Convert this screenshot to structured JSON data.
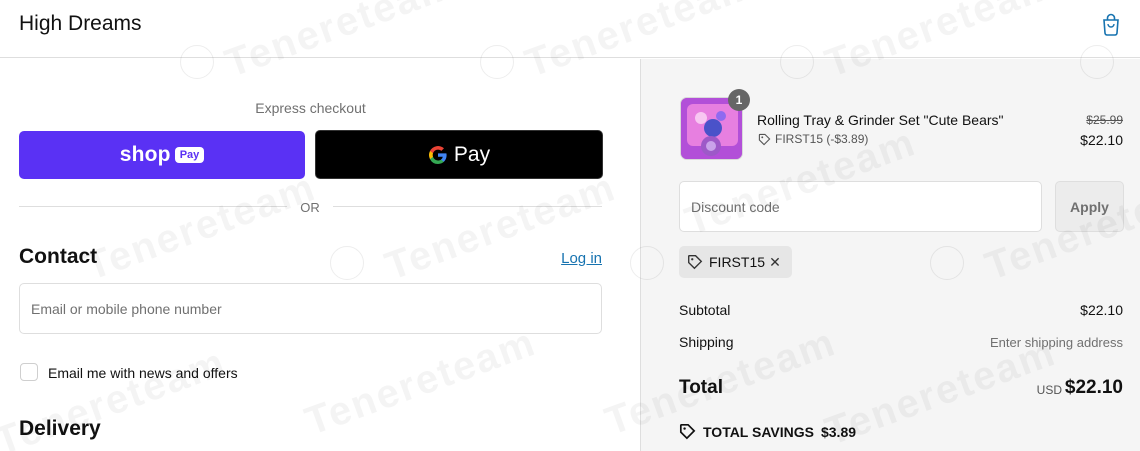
{
  "header": {
    "brand": "High Dreams",
    "cart_icon": "shopping-bag-icon"
  },
  "express": {
    "label": "Express checkout",
    "shop_pay": {
      "word": "shop",
      "chip": "Pay",
      "color": "#5a31f4"
    },
    "gpay": {
      "word": "Pay"
    },
    "or_label": "OR"
  },
  "contact": {
    "title": "Contact",
    "login_link": "Log in",
    "email_placeholder": "Email or mobile phone number",
    "newsletter_label": "Email me with news and offers"
  },
  "delivery": {
    "title": "Delivery"
  },
  "order": {
    "item": {
      "quantity": "1",
      "name": "Rolling Tray & Grinder Set \"Cute Bears\"",
      "discount": "FIRST15 (-$3.89)",
      "price_original": "$25.99",
      "price_final": "$22.10"
    },
    "discount_placeholder": "Discount code",
    "apply_label": "Apply",
    "applied_code": "FIRST15",
    "subtotal_label": "Subtotal",
    "subtotal_value": "$22.10",
    "shipping_label": "Shipping",
    "shipping_value": "Enter shipping address",
    "total_label": "Total",
    "total_currency": "USD",
    "total_value": "$22.10",
    "savings_label": "TOTAL SAVINGS",
    "savings_value": "$3.89"
  },
  "watermark": "Tenereteam",
  "colors": {
    "accent_link": "#1773b0",
    "shop_pay": "#5a31f4",
    "summary_bg": "#f5f5f5"
  }
}
